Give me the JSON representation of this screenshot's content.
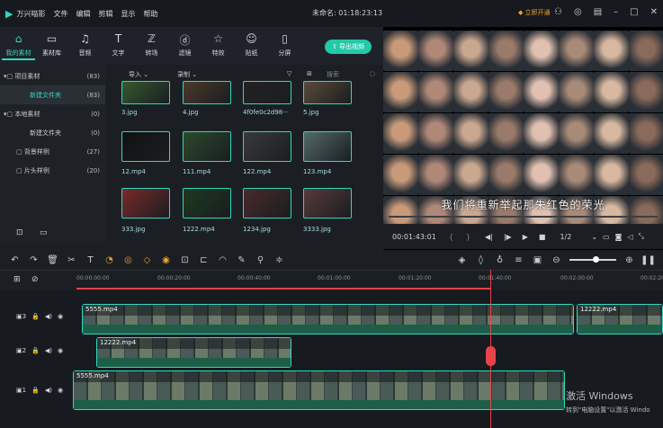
{
  "app": {
    "name": "万兴喵影",
    "doc_title": "未命名: 01:18:23:13",
    "vip": "立即开通",
    "menus": [
      "文件",
      "编辑",
      "剪辑",
      "显示",
      "帮助"
    ]
  },
  "toolbar": {
    "tabs": [
      {
        "label": "我的素材",
        "icon": "folder-icon",
        "glyph": "⌂"
      },
      {
        "label": "素材库",
        "icon": "folder-icon",
        "glyph": "▭"
      },
      {
        "label": "音频",
        "icon": "music-icon",
        "glyph": "♫"
      },
      {
        "label": "文字",
        "icon": "text-icon",
        "glyph": "T"
      },
      {
        "label": "转场",
        "icon": "transition-icon",
        "glyph": "ℤ"
      },
      {
        "label": "滤镜",
        "icon": "filter-icon",
        "glyph": "ⓓ"
      },
      {
        "label": "特效",
        "icon": "effect-icon",
        "glyph": "☆"
      },
      {
        "label": "贴纸",
        "icon": "sticker-icon",
        "glyph": "☺"
      },
      {
        "label": "分屏",
        "icon": "split-icon",
        "glyph": "▯"
      }
    ],
    "export_label": "导出视频"
  },
  "sidebar": {
    "items": [
      {
        "label": "项目素材",
        "count": "(83)"
      },
      {
        "label": "新建文件夹",
        "count": "(83)"
      },
      {
        "label": "本地素材",
        "count": "(0)"
      },
      {
        "label": "新建文件夹",
        "count": "(0)"
      },
      {
        "label": "背景样例",
        "count": "(27)"
      },
      {
        "label": "片头样例",
        "count": "(20)"
      }
    ]
  },
  "media": {
    "import_label": "导入",
    "record_label": "录制",
    "search_placeholder": "搜索",
    "items": [
      "3.jpg",
      "4.jpg",
      "4f0fe0c2d98···",
      "5.jpg",
      "12.mp4",
      "111.mp4",
      "122.mp4",
      "123.mp4",
      "333.jpg",
      "1222.mp4",
      "1234.jpg",
      "3333.jpg"
    ]
  },
  "preview": {
    "subtitle": "我们将重新举起那朱红色的荣光",
    "time": "00:01:43:01",
    "ratio": "1/2"
  },
  "ruler": {
    "ticks": [
      "00:00:00:00",
      "00:00:20:00",
      "00:00:40:00",
      "00:01:00:00",
      "00:01:20:00",
      "00:01:40:00",
      "00:02:00:00",
      "00:02:20"
    ]
  },
  "tracks": {
    "labels": [
      "3",
      "2",
      "1"
    ],
    "clips": [
      "5555.mp4",
      "12222.mp4",
      "12222.mp4",
      "5555.mp4"
    ]
  },
  "watermark": {
    "title": "激活 Windows",
    "sub": "转到\"电脑设置\"以激活 Windo"
  },
  "colors": {
    "accent": "#2fd9bf",
    "playhead": "#e8424a",
    "audio": "#1d5e48"
  }
}
